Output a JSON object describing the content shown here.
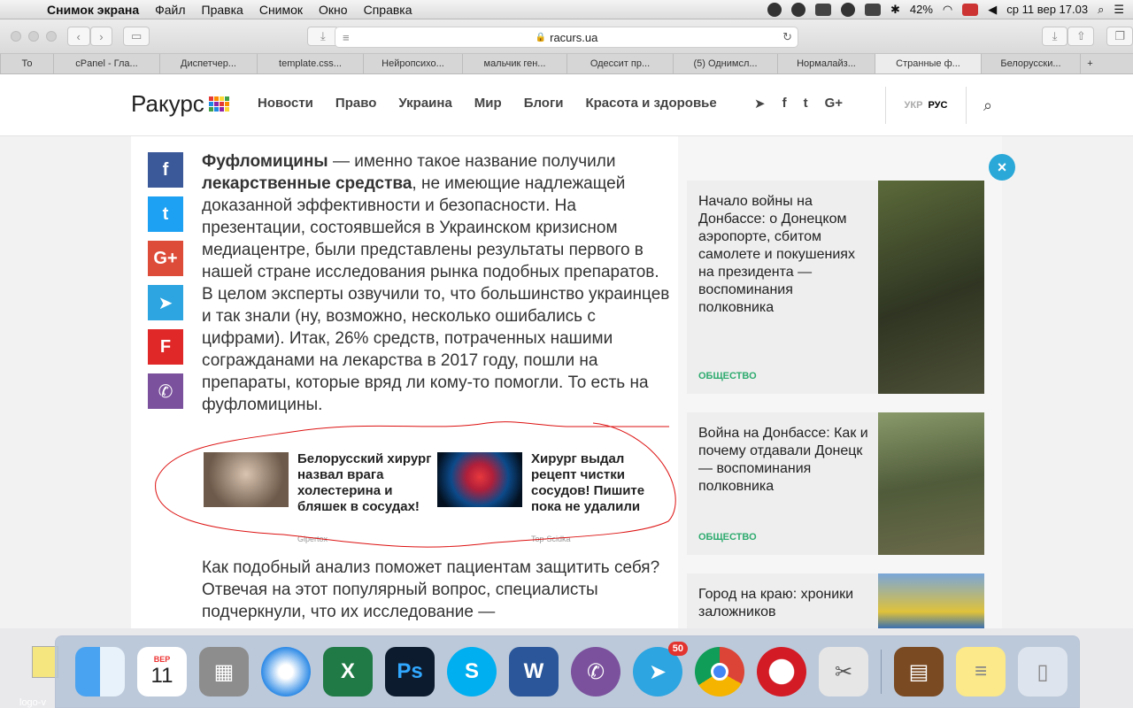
{
  "menubar": {
    "app": "Снимок экрана",
    "items": [
      "Файл",
      "Правка",
      "Снимок",
      "Окно",
      "Справка"
    ],
    "battery": "42%",
    "clock": "ср 11 вер  17.03"
  },
  "browser": {
    "url": "racurs.ua",
    "tabs": [
      "То",
      "cPanel - Гла...",
      "Диспетчер...",
      "template.css...",
      "Нейропсихо...",
      "мальчик ген...",
      "Одессит пр...",
      "(5) Однимсл...",
      "Нормалайз...",
      "Странные ф...",
      "Белорусски..."
    ],
    "active_tab": 9
  },
  "site": {
    "logo": "Ракурс",
    "logo_colors": [
      "#e53935",
      "#fb8c00",
      "#fdd835",
      "#43a047",
      "#1e88e5",
      "#8e24aa",
      "#e53935",
      "#fb8c00",
      "#43a047",
      "#1e88e5",
      "#8e24aa",
      "#fdd835"
    ],
    "nav": [
      "Новости",
      "Право",
      "Украина",
      "Мир",
      "Блоги",
      "Красота и здоровье"
    ],
    "social": [
      "telegram-icon",
      "facebook-icon",
      "twitter-icon",
      "google-plus-icon"
    ],
    "lang_off": "УКР",
    "lang_on": "РУС"
  },
  "share": [
    {
      "icon": "facebook-icon",
      "glyph": "f",
      "color": "#3b5998"
    },
    {
      "icon": "twitter-icon",
      "glyph": "t",
      "color": "#1da1f2"
    },
    {
      "icon": "google-plus-icon",
      "glyph": "G+",
      "color": "#dd4b39"
    },
    {
      "icon": "telegram-icon",
      "glyph": "➤",
      "color": "#2ca5e0"
    },
    {
      "icon": "flipboard-icon",
      "glyph": "F",
      "color": "#e12828"
    },
    {
      "icon": "viber-icon",
      "glyph": "✆",
      "color": "#7b519d"
    }
  ],
  "article": {
    "bold1": "Фуфломицины",
    "text1": " — именно такое название получили ",
    "bold2": "лекарственные средства",
    "text2": ", не имеющие надлежащей доказанной эффективности и безопасности. На презентации, состоявшейся в Украинском кризисном медиацентре, были представлены результаты первого в нашей стране исследования рынка подобных препаратов. В целом эксперты озвучили то, что большинство украинцев и так знали (ну, возможно, несколько ошибались с цифрами). Итак, 26% средств, потраченных нашими согражданами на лекарства в 2017 году, пошли на препараты, которые вряд ли кому-то помогли. То есть на фуфломицины.",
    "para2": "Как подобный анализ поможет пациентам защитить себя? Отвечая на этот популярный вопрос, специалисты подчеркнули, что их исследование —"
  },
  "promo": [
    {
      "title": "Белорусский хирург назвал врага холестерина и бляшек в сосудах!",
      "source": "Gipertox"
    },
    {
      "title": "Хирург выдал рецепт чистки сосудов! Пишите пока не удалили",
      "source": "Top-Scidka"
    }
  ],
  "sidebar": [
    {
      "title": "Начало войны на Донбассе: о Донецком аэропорте, сбитом самолете и покушениях на президента — воспоминания полковника",
      "category": "ОБЩЕСТВО"
    },
    {
      "title": "Война на Донбассе: Как и почему отдавали Донецк — воспоминания полковника",
      "category": "ОБЩЕСТВО"
    },
    {
      "title": "Город на краю: хроники заложников",
      "category": ""
    }
  ],
  "dock": {
    "calendar_month": "ВЕР",
    "calendar_day": "11",
    "telegram_badge": "50",
    "apps": [
      "Finder",
      "Calendar",
      "Calculator",
      "Safari",
      "Excel",
      "Photoshop",
      "Skype",
      "Word",
      "Viber",
      "Telegram",
      "Chrome",
      "Opera",
      "Scissors",
      "Archive Utility",
      "Notes",
      "Trash"
    ]
  },
  "desktop": {
    "label": "logo-v"
  }
}
